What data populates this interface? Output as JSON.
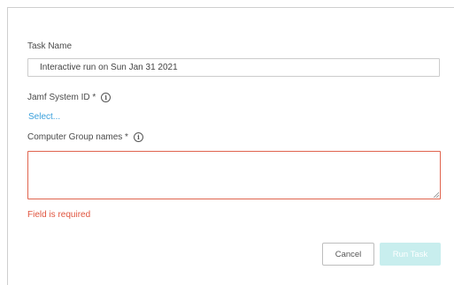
{
  "form": {
    "task_name": {
      "label": "Task Name",
      "value": "Interactive run on Sun Jan 31 2021"
    },
    "jamf_system_id": {
      "label": "Jamf System ID *",
      "select_label": "Select..."
    },
    "computer_group_names": {
      "label": "Computer Group names *",
      "value": "",
      "error": "Field is required"
    }
  },
  "actions": {
    "cancel_label": "Cancel",
    "run_label": "Run Task"
  },
  "colors": {
    "link": "#3aa0dc",
    "error": "#e0543e",
    "primary_disabled": "#c8eeee"
  },
  "icons": {
    "info": "info-circle-icon",
    "resize": "resize-grip-icon"
  }
}
